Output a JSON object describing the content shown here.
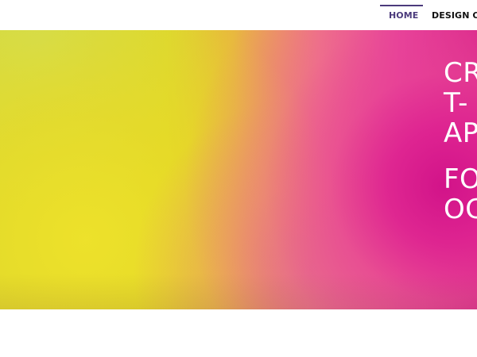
{
  "nav": {
    "items": [
      {
        "label": "HOME",
        "active": true
      },
      {
        "label": "DESIGN ON"
      }
    ],
    "active_color": "#4b3a7c",
    "text_color": "#111111"
  },
  "hero": {
    "lines": [
      "CR",
      "T-",
      "AP",
      "FO",
      "OC"
    ],
    "text_color": "#ffffff",
    "gradient_colors": [
      "#d8d92c",
      "#e0d622",
      "#ef7684",
      "#d31385"
    ]
  }
}
